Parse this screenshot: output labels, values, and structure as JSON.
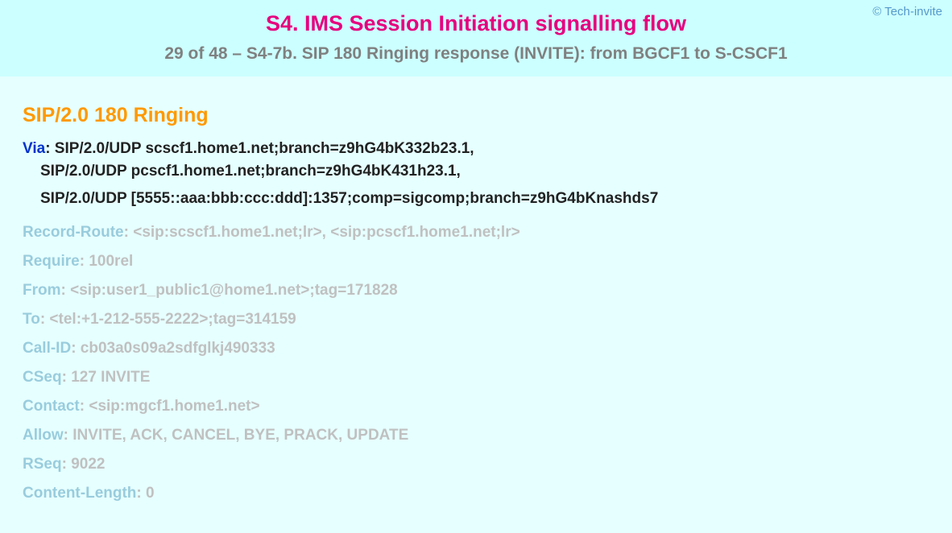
{
  "copyright": "© Tech-invite",
  "title": "S4. IMS Session Initiation signalling flow",
  "subtitle": "29 of 48 – S4-7b. SIP 180 Ringing response (INVITE): from BGCF1 to S-CSCF1",
  "sip_status": "SIP/2.0 180 Ringing",
  "via": {
    "label": "Via",
    "line1": "SIP/2.0/UDP scscf1.home1.net;branch=z9hG4bK332b23.1,",
    "line2": "SIP/2.0/UDP pcscf1.home1.net;branch=z9hG4bK431h23.1,",
    "line3": "SIP/2.0/UDP [5555::aaa:bbb:ccc:ddd]:1357;comp=sigcomp;branch=z9hG4bKnashds7"
  },
  "headers": [
    {
      "label": "Record-Route",
      "value": "<sip:scscf1.home1.net;lr>, <sip:pcscf1.home1.net;lr>"
    },
    {
      "label": "Require",
      "value": "100rel"
    },
    {
      "label": "From",
      "value": "<sip:user1_public1@home1.net>;tag=171828"
    },
    {
      "label": "To",
      "value": "<tel:+1-212-555-2222>;tag=314159"
    },
    {
      "label": "Call-ID",
      "value": "cb03a0s09a2sdfglkj490333"
    },
    {
      "label": "CSeq",
      "value": "127 INVITE"
    },
    {
      "label": "Contact",
      "value": "<sip:mgcf1.home1.net>"
    },
    {
      "label": "Allow",
      "value": "INVITE, ACK, CANCEL, BYE, PRACK, UPDATE"
    },
    {
      "label": "RSeq",
      "value": "9022"
    },
    {
      "label": "Content-Length",
      "value": "0"
    }
  ]
}
